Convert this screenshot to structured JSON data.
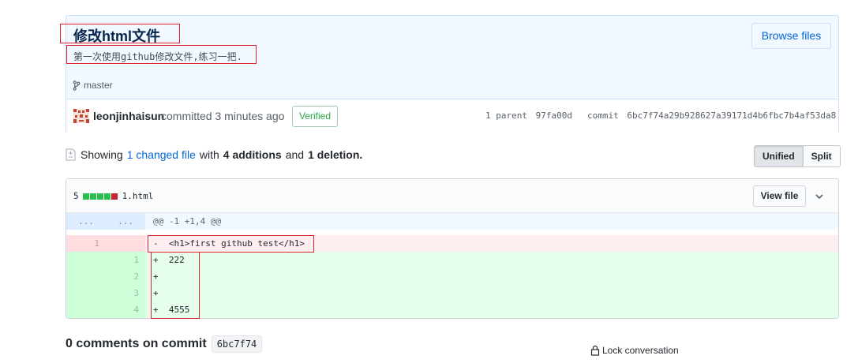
{
  "commit": {
    "title": "修改html文件",
    "description": "第一次使用github修改文件,练习一把.",
    "browse_files_label": "Browse files",
    "branch": "master",
    "author": "leonjinhaisun",
    "committed_text": "committed 3 minutes ago",
    "verified_label": "Verified",
    "parent_label": "1 parent",
    "parent_sha": "97fa00d",
    "commit_label": "commit",
    "commit_sha": "6bc7f74a29b928627a39171d4b6fbc7b4af53da8"
  },
  "summary": {
    "prefix": "Showing",
    "changed_link": "1 changed file",
    "with_text": "with",
    "additions": "4 additions",
    "and_text": "and",
    "deletions": "1 deletion.",
    "view_unified": "Unified",
    "view_split": "Split"
  },
  "file": {
    "change_count": "5",
    "name": "1.html",
    "view_file_label": "View file",
    "hunk_header": "@@ -1 +1,4 @@",
    "hunk_ellipsis_left": "...",
    "hunk_ellipsis_right": "...",
    "lines": [
      {
        "type": "del",
        "old": "1",
        "new": "",
        "text": "-  <h1>first github test</h1>"
      },
      {
        "type": "add",
        "old": "",
        "new": "1",
        "text": "+  222"
      },
      {
        "type": "add",
        "old": "",
        "new": "2",
        "text": "+"
      },
      {
        "type": "add",
        "old": "",
        "new": "3",
        "text": "+"
      },
      {
        "type": "add",
        "old": "",
        "new": "4",
        "text": "+  4555"
      }
    ]
  },
  "footer": {
    "comments_label": "0 comments on commit",
    "short_sha": "6bc7f74",
    "lock_label": "Lock conversation"
  },
  "colors": {
    "link": "#0366d6",
    "addition": "#2cbe4e",
    "deletion": "#cb2431",
    "annotation": "#e0232e"
  }
}
